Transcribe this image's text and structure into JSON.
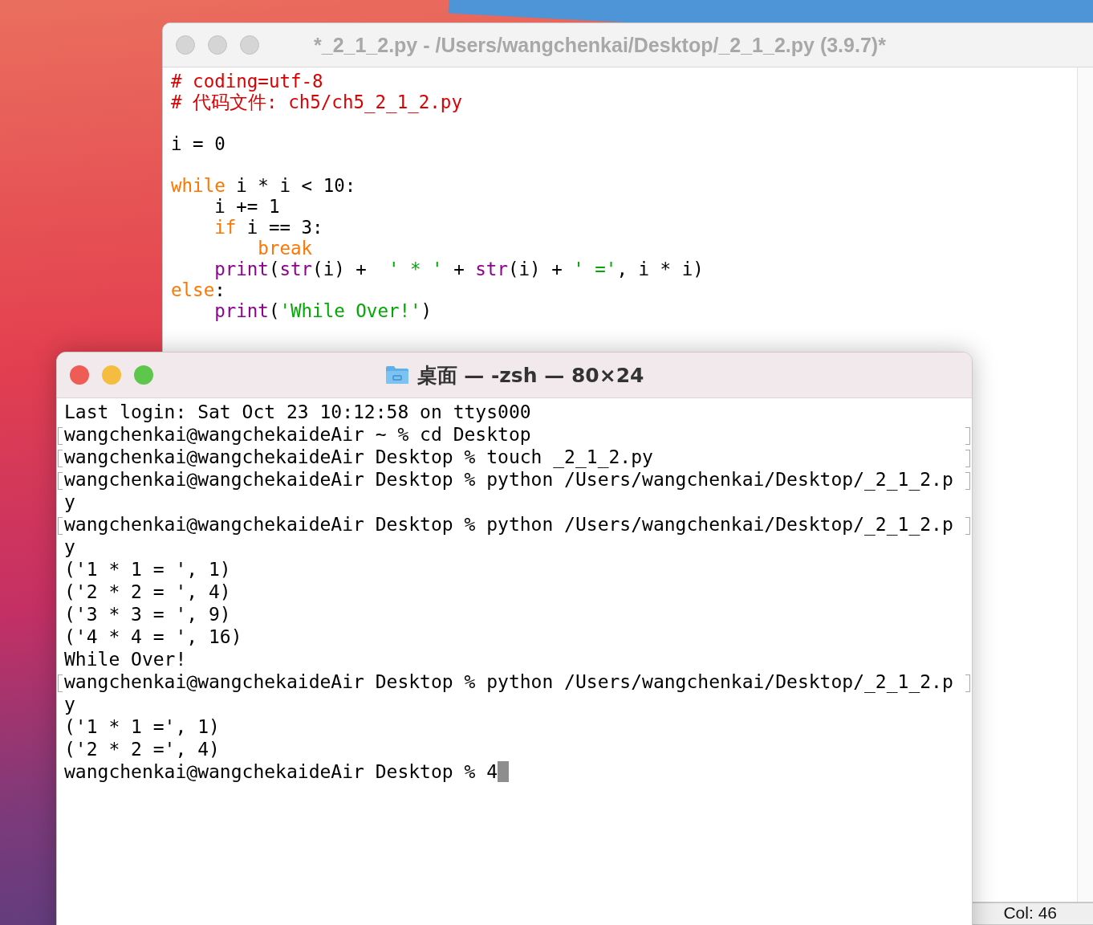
{
  "editor": {
    "title": "*_2_1_2.py - /Users/wangchenkai/Desktop/_2_1_2.py (3.9.7)*",
    "active": false,
    "lines": [
      {
        "kind": "code",
        "tokens": [
          {
            "kind": "comment",
            "text": "# coding=utf-8"
          }
        ]
      },
      {
        "kind": "code",
        "tokens": [
          {
            "kind": "comment",
            "text": "# 代码文件: ch5/ch5_2_1_2.py"
          }
        ]
      },
      {
        "kind": "blank"
      },
      {
        "kind": "code",
        "tokens": [
          {
            "kind": "plain",
            "text": "i = 0"
          }
        ]
      },
      {
        "kind": "blank"
      },
      {
        "kind": "code",
        "tokens": [
          {
            "kind": "keyword",
            "text": "while"
          },
          {
            "kind": "plain",
            "text": " i * i < 10:"
          }
        ]
      },
      {
        "kind": "code",
        "tokens": [
          {
            "kind": "plain",
            "text": "    i += 1"
          }
        ]
      },
      {
        "kind": "code",
        "tokens": [
          {
            "kind": "keyword",
            "text": "    if"
          },
          {
            "kind": "plain",
            "text": " i == 3:"
          }
        ]
      },
      {
        "kind": "code",
        "tokens": [
          {
            "kind": "keyword",
            "text": "        break"
          }
        ]
      },
      {
        "kind": "code",
        "tokens": [
          {
            "kind": "builtin",
            "text": "    print"
          },
          {
            "kind": "plain",
            "text": "("
          },
          {
            "kind": "builtin",
            "text": "str"
          },
          {
            "kind": "plain",
            "text": "(i) +  "
          },
          {
            "kind": "string",
            "text": "' * '"
          },
          {
            "kind": "plain",
            "text": " + "
          },
          {
            "kind": "builtin",
            "text": "str"
          },
          {
            "kind": "plain",
            "text": "(i) + "
          },
          {
            "kind": "string",
            "text": "' ='"
          },
          {
            "kind": "plain",
            "text": ", i * i)"
          }
        ]
      },
      {
        "kind": "code",
        "tokens": [
          {
            "kind": "keyword",
            "text": "else"
          },
          {
            "kind": "plain",
            "text": ":"
          }
        ]
      },
      {
        "kind": "code",
        "tokens": [
          {
            "kind": "builtin",
            "text": "    print"
          },
          {
            "kind": "plain",
            "text": "("
          },
          {
            "kind": "string",
            "text": "'While Over!'"
          },
          {
            "kind": "plain",
            "text": ")"
          }
        ]
      }
    ],
    "status_bar": "Col: 46"
  },
  "terminal": {
    "title": "桌面 — -zsh — 80×24",
    "active": true,
    "lines": [
      {
        "text": "Last login: Sat Oct 23 10:12:58 on ttys000",
        "marked": false
      },
      {
        "text": "wangchenkai@wangchekaideAir ~ % cd Desktop",
        "marked": true
      },
      {
        "text": "wangchenkai@wangchekaideAir Desktop % touch _2_1_2.py",
        "marked": true
      },
      {
        "text": "wangchenkai@wangchekaideAir Desktop % python /Users/wangchenkai/Desktop/_2_1_2.p",
        "marked": true
      },
      {
        "text": "y",
        "marked": false
      },
      {
        "text": "wangchenkai@wangchekaideAir Desktop % python /Users/wangchenkai/Desktop/_2_1_2.p",
        "marked": true
      },
      {
        "text": "y",
        "marked": false
      },
      {
        "text": "('1 * 1 = ', 1)",
        "marked": false
      },
      {
        "text": "('2 * 2 = ', 4)",
        "marked": false
      },
      {
        "text": "('3 * 3 = ', 9)",
        "marked": false
      },
      {
        "text": "('4 * 4 = ', 16)",
        "marked": false
      },
      {
        "text": "While Over!",
        "marked": false
      },
      {
        "text": "wangchenkai@wangchekaideAir Desktop % python /Users/wangchenkai/Desktop/_2_1_2.p",
        "marked": true
      },
      {
        "text": "y",
        "marked": false
      },
      {
        "text": "('1 * 1 =', 1)",
        "marked": false
      },
      {
        "text": "('2 * 2 =', 4)",
        "marked": false
      },
      {
        "text": "wangchenkai@wangchekaideAir Desktop % 4",
        "marked": false
      }
    ]
  }
}
